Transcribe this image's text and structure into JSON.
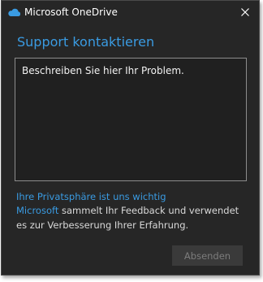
{
  "window": {
    "title": "Microsoft OneDrive",
    "close_glyph": "✕",
    "app_icon": "onedrive-cloud-icon"
  },
  "form": {
    "heading": "Support kontaktieren",
    "problem_value": "Beschreiben Sie hier Ihr Problem.",
    "privacy_link": "Ihre Privatsphäre ist uns wichtig",
    "info_link": "Microsoft",
    "info_text": " sammelt Ihr Feedback und verwendet es zur Verbesserung Ihrer Erfahrung.",
    "send_label": "Absenden"
  },
  "colors": {
    "background": "#262626",
    "accent": "#3a9be2",
    "text": "#ffffff",
    "disabled_button": "#3a3a3a"
  }
}
